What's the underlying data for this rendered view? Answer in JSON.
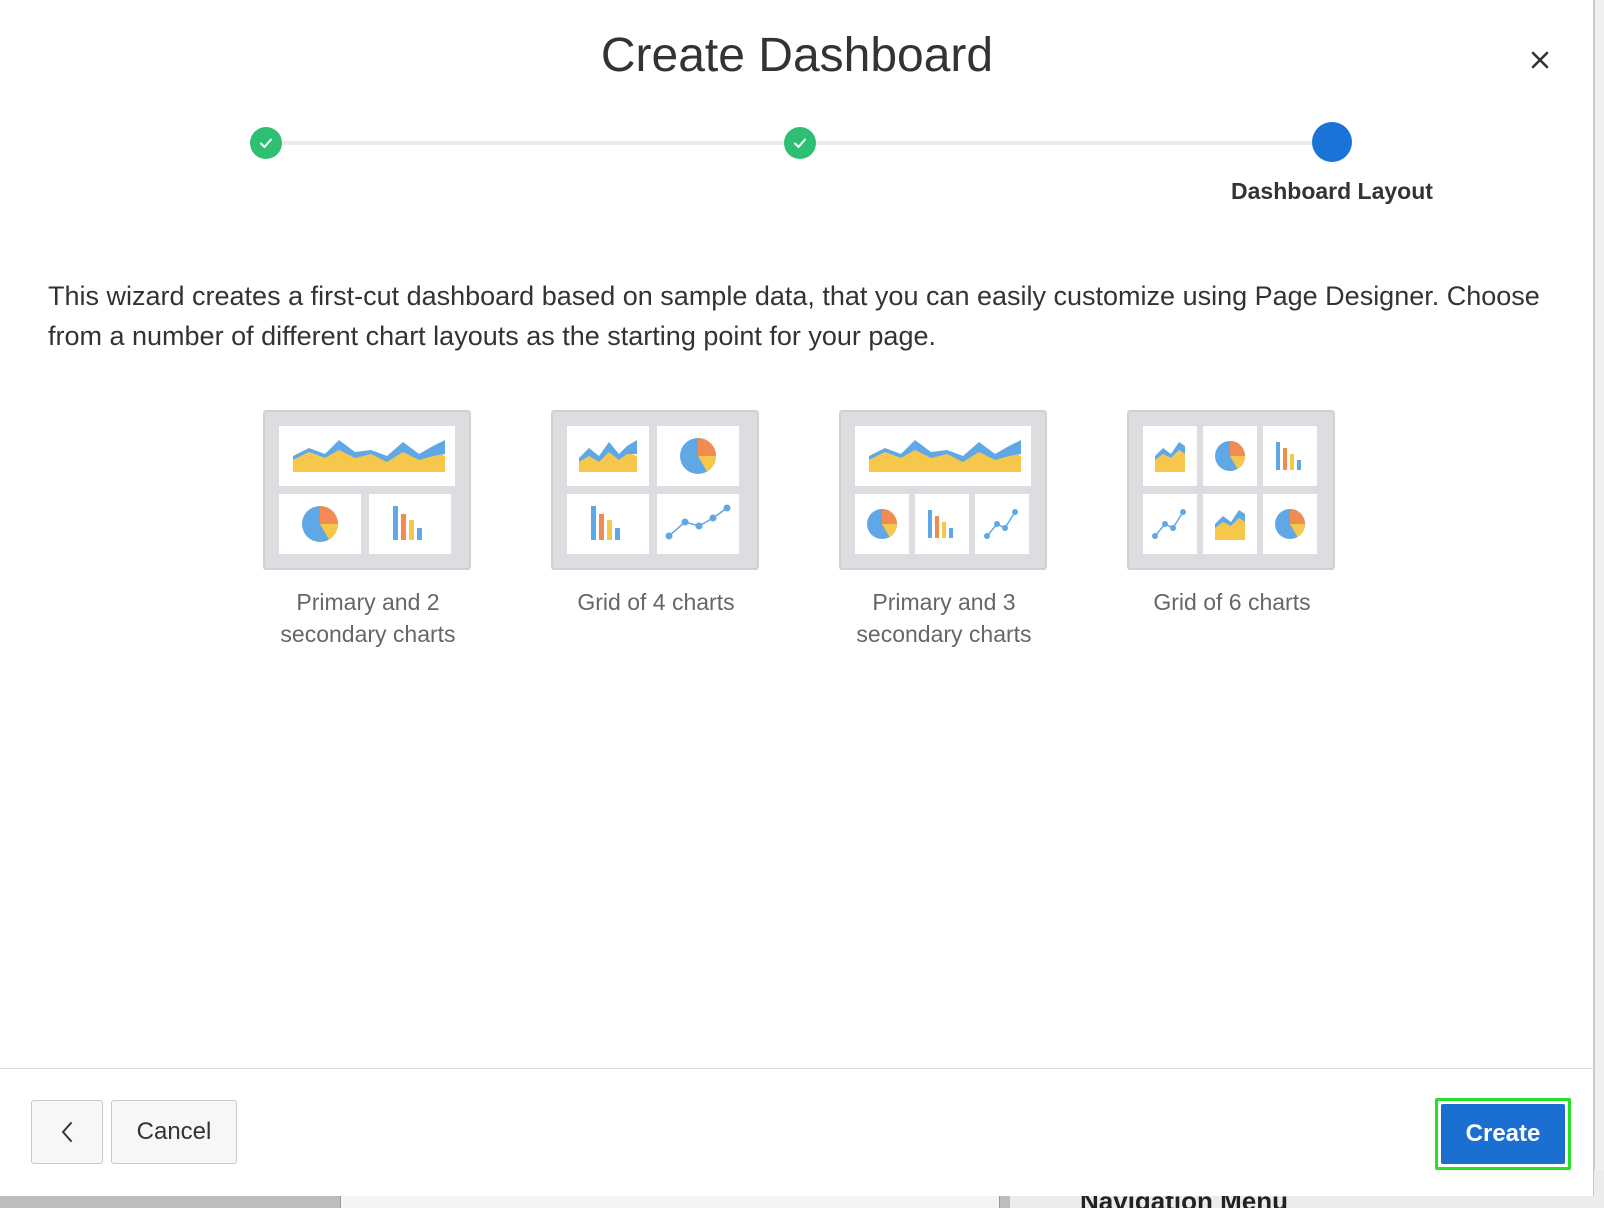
{
  "dialog": {
    "title": "Create Dashboard",
    "close_icon": "close-icon"
  },
  "wizard": {
    "steps": [
      {
        "status": "complete",
        "icon": "check-icon"
      },
      {
        "status": "complete",
        "icon": "check-icon"
      },
      {
        "status": "current",
        "label": "Dashboard Layout"
      }
    ],
    "colors": {
      "complete": "#2ebf73",
      "current": "#1a73d6"
    }
  },
  "description": "This wizard creates a first-cut dashboard based on sample data, that you can easily customize using Page Designer. Choose from a number of different chart layouts as the starting point for your page.",
  "layouts": [
    {
      "label_line1": "Primary and 2",
      "label_line2": "secondary charts"
    },
    {
      "label_line1": "Grid of 4 charts",
      "label_line2": ""
    },
    {
      "label_line1": "Primary and 3",
      "label_line2": "secondary charts"
    },
    {
      "label_line1": "Grid of 6 charts",
      "label_line2": ""
    }
  ],
  "footer": {
    "back_icon": "chevron-left-icon",
    "cancel_label": "Cancel",
    "create_label": "Create"
  },
  "background": {
    "nav_text": "Navigation Menu"
  }
}
